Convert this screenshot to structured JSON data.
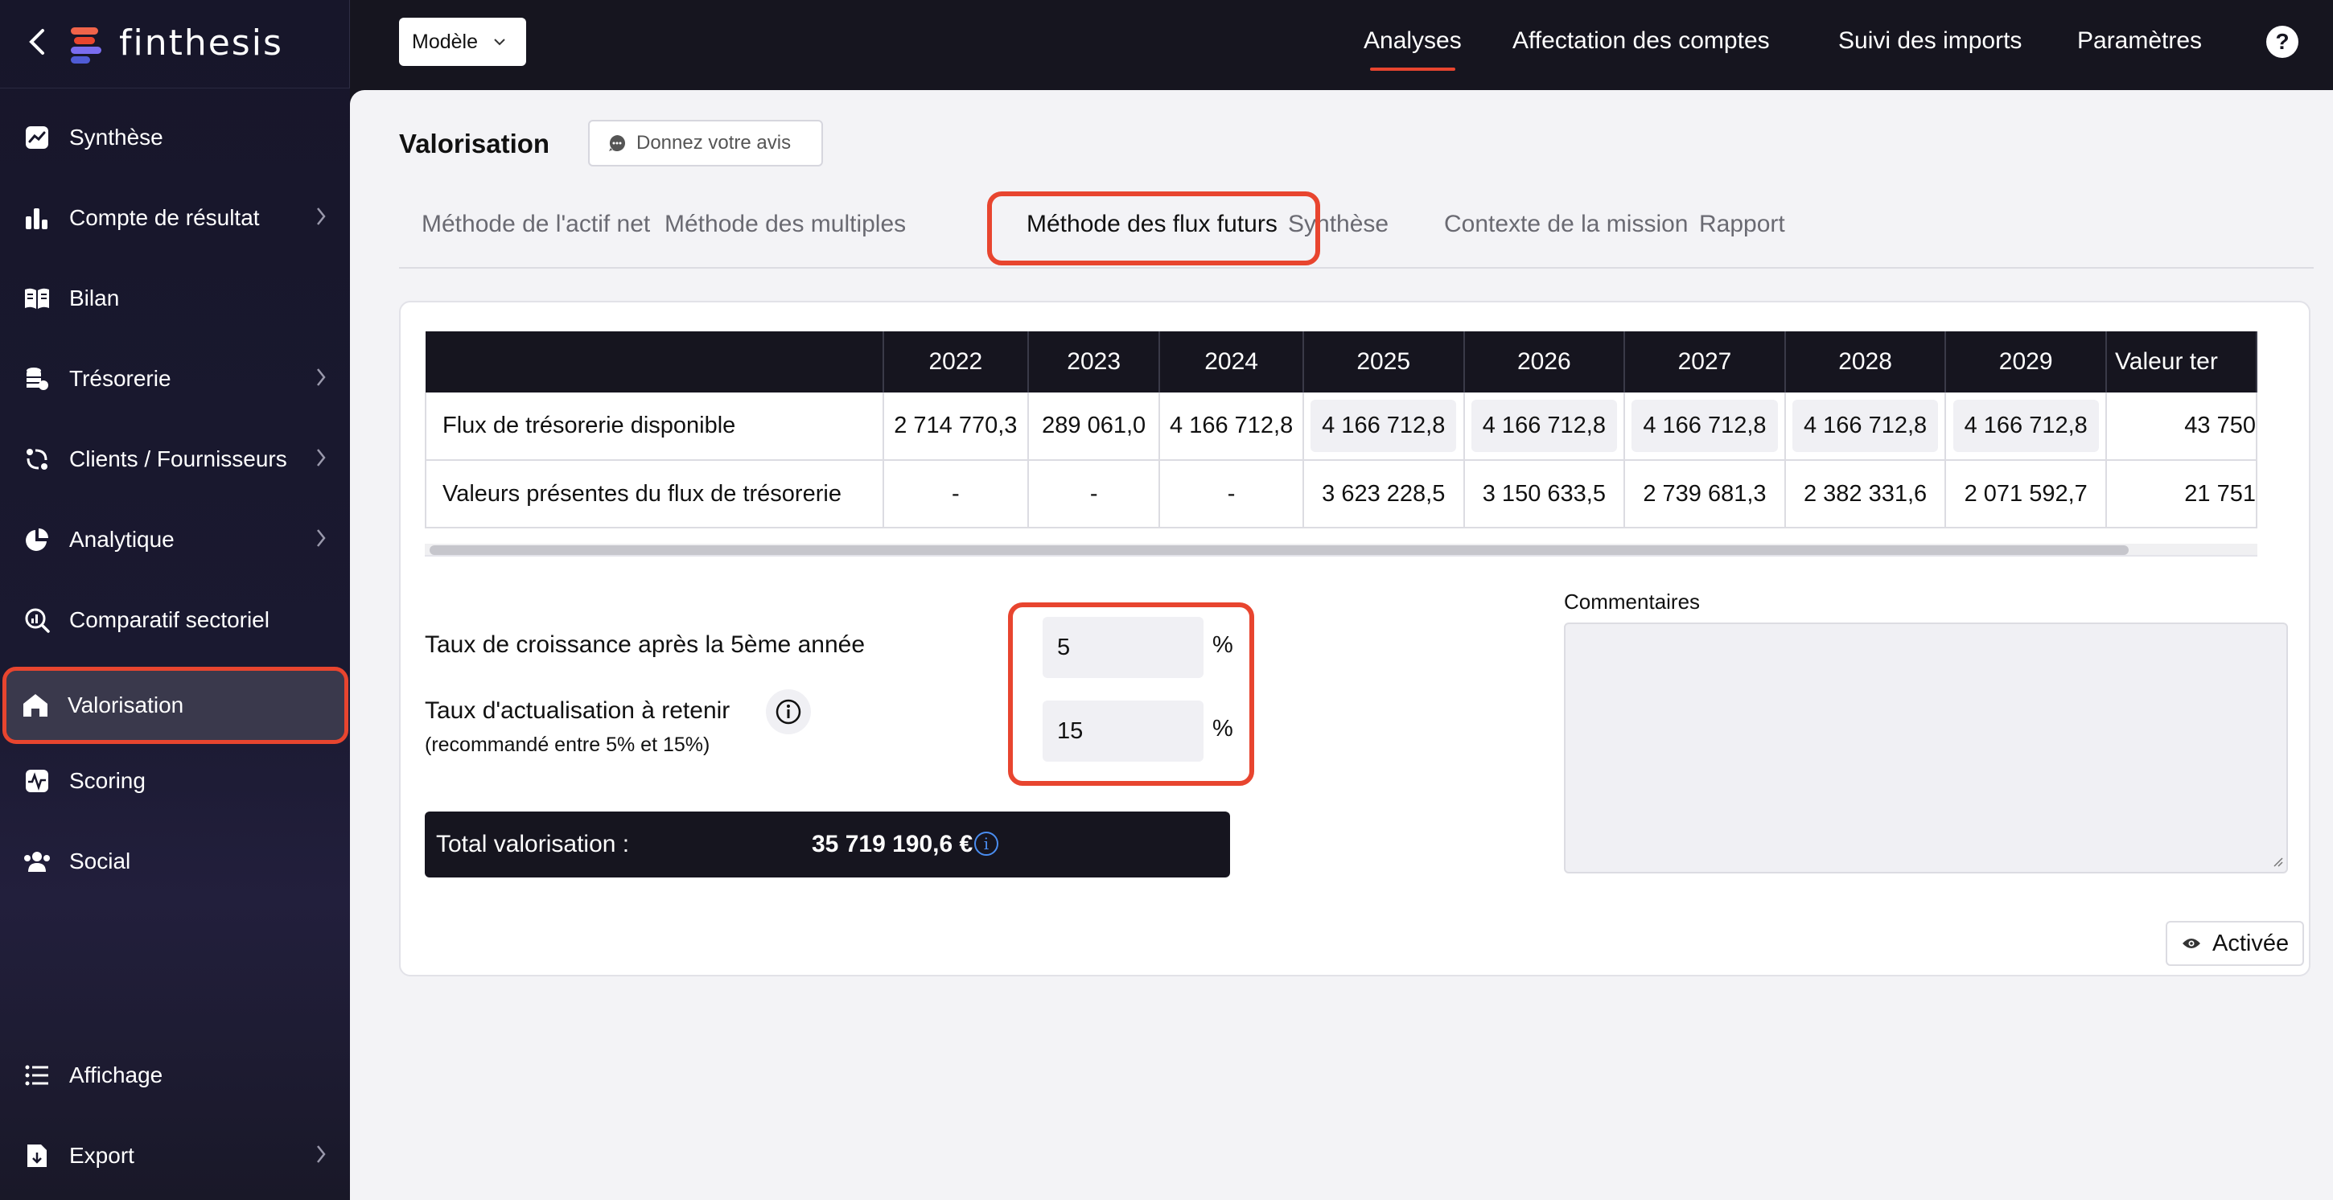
{
  "app": {
    "name": "finthesis"
  },
  "sidebar": {
    "items": [
      {
        "label": "Synthèse",
        "icon": "trend-chart-icon",
        "chevron": false
      },
      {
        "label": "Compte de résultat",
        "icon": "bar-chart-icon",
        "chevron": true
      },
      {
        "label": "Bilan",
        "icon": "book-icon",
        "chevron": false
      },
      {
        "label": "Trésorerie",
        "icon": "coins-icon",
        "chevron": true
      },
      {
        "label": "Clients / Fournisseurs",
        "icon": "exchange-icon",
        "chevron": true
      },
      {
        "label": "Analytique",
        "icon": "pie-chart-icon",
        "chevron": true
      },
      {
        "label": "Comparatif sectoriel",
        "icon": "search-chart-icon",
        "chevron": false
      },
      {
        "label": "Valorisation",
        "icon": "home-icon",
        "chevron": false,
        "active": true
      },
      {
        "label": "Scoring",
        "icon": "pulse-icon",
        "chevron": false
      },
      {
        "label": "Social",
        "icon": "users-icon",
        "chevron": false
      }
    ],
    "bottom": [
      {
        "label": "Affichage",
        "icon": "list-icon",
        "chevron": false
      },
      {
        "label": "Export",
        "icon": "export-icon",
        "chevron": true
      }
    ]
  },
  "topbar": {
    "model_select": "Modèle",
    "nav": [
      "Analyses",
      "Affectation des comptes",
      "Suivi des imports",
      "Paramètres"
    ],
    "help": "?"
  },
  "page": {
    "title": "Valorisation",
    "feedback_button": "Donnez votre avis",
    "tabs": [
      "Méthode de l'actif net",
      "Méthode des multiples",
      "Méthode des flux futurs",
      "Synthèse",
      "Contexte de la mission",
      "Rapport"
    ],
    "active_tab": "Méthode des flux futurs"
  },
  "table": {
    "headers": [
      "",
      "2022",
      "2023",
      "2024",
      "2025",
      "2026",
      "2027",
      "2028",
      "2029",
      "Valeur ter"
    ],
    "rows": [
      {
        "label": "Flux de trésorerie disponible",
        "cells": [
          "2 714 770,3",
          "289 061,0",
          "4 166 712,8",
          "4 166 712,8",
          "4 166 712,8",
          "4 166 712,8",
          "4 166 712,8",
          "4 166 712,8",
          "43 750"
        ]
      },
      {
        "label": "Valeurs présentes du flux de trésorerie",
        "cells": [
          "-",
          "-",
          "-",
          "3 623 228,5",
          "3 150 633,5",
          "2 739 681,3",
          "2 382 331,6",
          "2 071 592,7",
          "21 751"
        ]
      }
    ]
  },
  "form": {
    "growth_label": "Taux de croissance après la 5ème année",
    "growth_value": "5",
    "discount_label": "Taux d'actualisation à retenir",
    "discount_note": "(recommandé entre 5% et 15%)",
    "discount_value": "15",
    "percent": "%",
    "total_label": "Total valorisation :",
    "total_value": "35 719 190,6 €",
    "comments_label": "Commentaires",
    "activated_button": "Activée"
  },
  "colors": {
    "accent": "#e8452f",
    "dark": "#16151f",
    "info": "#4a8df0"
  }
}
